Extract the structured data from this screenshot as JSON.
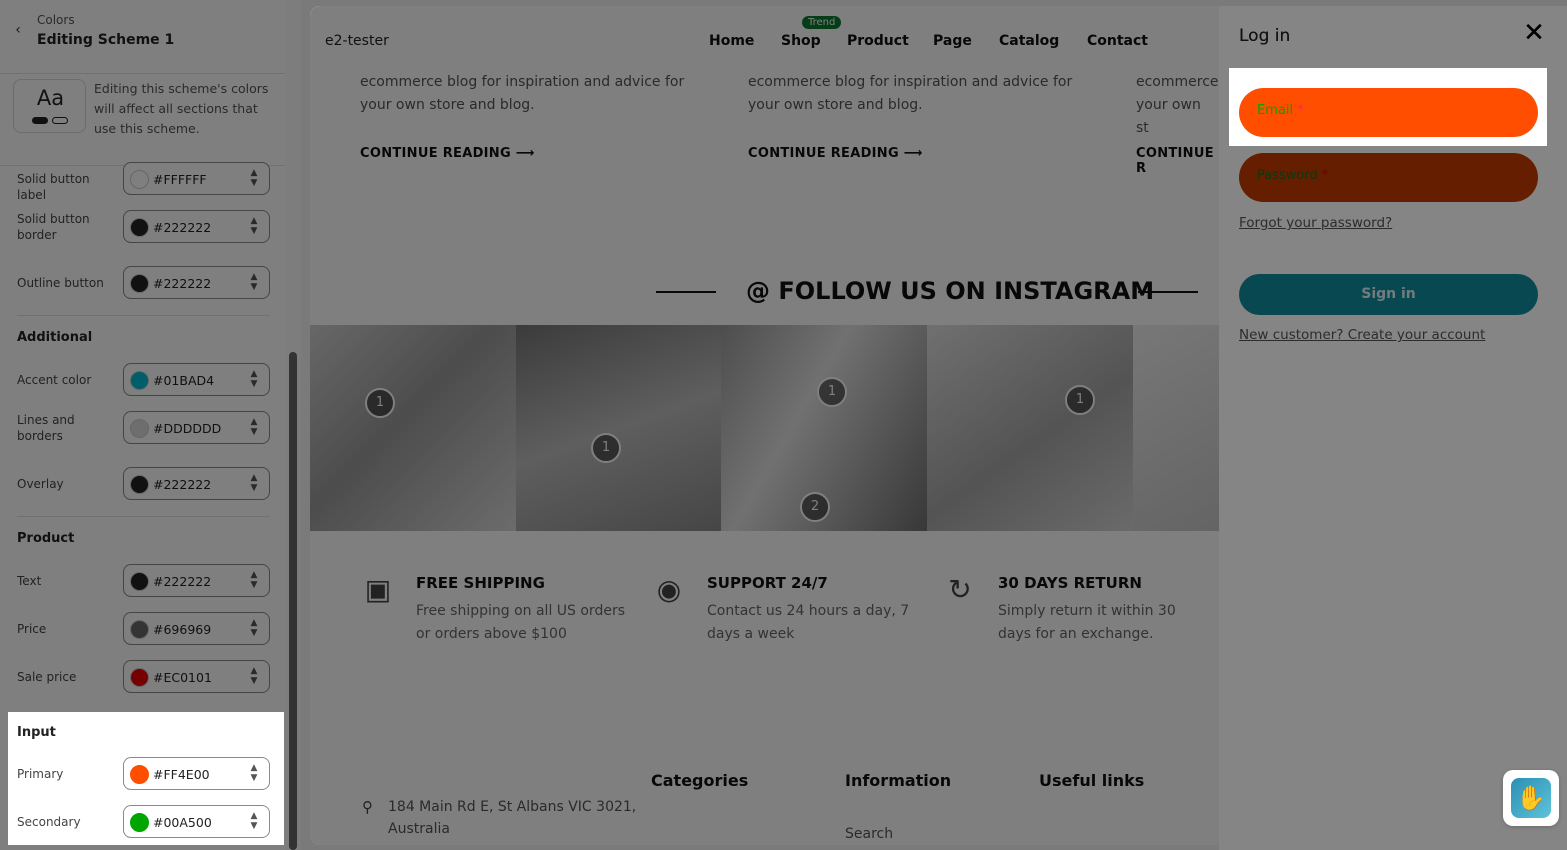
{
  "sidebar": {
    "back_icon": "chevron-left-icon",
    "subtitle": "Colors",
    "title": "Editing Scheme 1",
    "preview_text": "Aa",
    "description": "Editing this scheme's colors will affect all sections that use this scheme.",
    "rows_top": [
      {
        "label": "Solid button label",
        "value": "#FFFFFF",
        "color": "#FFFFFF"
      },
      {
        "label": "Solid button border",
        "value": "#222222",
        "color": "#222222"
      },
      {
        "label": "Outline button",
        "value": "#222222",
        "color": "#222222"
      }
    ],
    "additional": {
      "title": "Additional",
      "rows": [
        {
          "label": "Accent color",
          "value": "#01BAD4",
          "color": "#01BAD4"
        },
        {
          "label": "Lines and borders",
          "value": "#DDDDDD",
          "color": "#DDDDDD"
        },
        {
          "label": "Overlay",
          "value": "#222222",
          "color": "#222222"
        }
      ]
    },
    "product": {
      "title": "Product",
      "rows": [
        {
          "label": "Text",
          "value": "#222222",
          "color": "#222222"
        },
        {
          "label": "Price",
          "value": "#696969",
          "color": "#696969"
        },
        {
          "label": "Sale price",
          "value": "#EC0101",
          "color": "#EC0101"
        }
      ]
    },
    "input": {
      "title": "Input",
      "rows": [
        {
          "label": "Primary",
          "value": "#FF4E00",
          "color": "#FF4E00"
        },
        {
          "label": "Secondary",
          "value": "#00A500",
          "color": "#00A500"
        }
      ]
    }
  },
  "preview": {
    "brand": "e2-tester",
    "nav": [
      "Home",
      "Shop",
      "Product",
      "Page",
      "Catalog",
      "Contact"
    ],
    "nav_badge": "Trend",
    "blog_text": "ecommerce blog for inspiration and advice for your own store and blog.",
    "blog_text_partial": "ecommerce your own st",
    "continue": "CONTINUE READING",
    "continue_partial": "CONTINUE R",
    "instagram_title": "@ FOLLOW US ON INSTAGRAM",
    "pins": [
      "1",
      "1",
      "1",
      "2",
      "1"
    ],
    "features": [
      {
        "icon": "truck-icon",
        "title": "FREE SHIPPING",
        "desc": "Free shipping on all US orders or orders above $100"
      },
      {
        "icon": "lifebuoy-icon",
        "title": "SUPPORT 24/7",
        "desc": "Contact us 24 hours a day, 7 days a week"
      },
      {
        "icon": "return-icon",
        "title": "30 DAYS RETURN",
        "desc": "Simply return it within 30 days for an exchange."
      }
    ],
    "footer": {
      "address": "184 Main Rd E, St Albans VIC 3021, Australia",
      "headings": [
        "Categories",
        "Information",
        "Useful links"
      ],
      "search": "Search"
    }
  },
  "login": {
    "title": "Log in",
    "close_icon": "close-icon",
    "email_label": "Email",
    "password_label": "Password",
    "required_mark": "*",
    "forgot": "Forgot your password?",
    "sign_in": "Sign in",
    "create": "New customer? Create your account",
    "primary_color": "#FF4E00",
    "secondary_color": "#00A500"
  }
}
